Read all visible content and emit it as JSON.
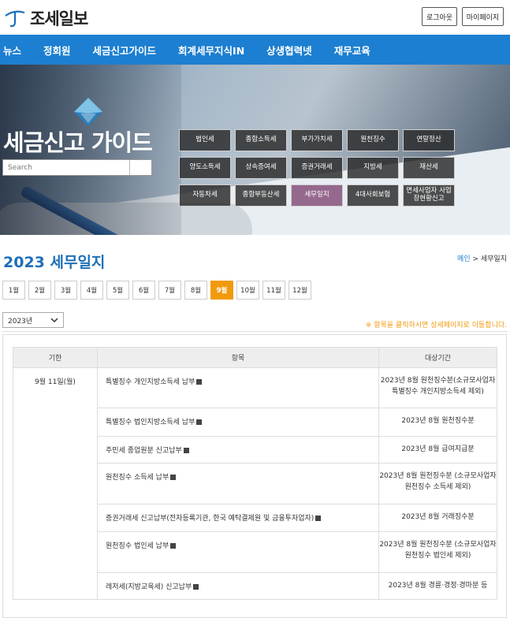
{
  "header": {
    "logo_text": "조세일보",
    "logout_label": "로그아웃",
    "mypage_label": "마이페이지"
  },
  "nav": {
    "items": [
      "뉴스",
      "정회원",
      "세금신고가이드",
      "회계세무지식IN",
      "상생협력넷",
      "재무교육"
    ]
  },
  "banner": {
    "title": "세금신고 가이드",
    "search_placeholder": "Search",
    "tax_buttons": [
      "법인세",
      "종합소득세",
      "부가가치세",
      "원천징수",
      "연말정산",
      "양도소득세",
      "상속증여세",
      "증권거래세",
      "지방세",
      "재산세",
      "자동차세",
      "종합부동산세",
      "세무일지",
      "4대사회보험",
      "면세사업자 사업장현황신고"
    ],
    "active_button": "세무일지"
  },
  "page": {
    "title": "2023 세무일지",
    "breadcrumb_home": "메인",
    "breadcrumb_sep": " > ",
    "breadcrumb_current": "세무일지"
  },
  "months": [
    "1월",
    "2월",
    "3월",
    "4월",
    "5월",
    "6월",
    "7월",
    "8월",
    "9월",
    "10월",
    "11월",
    "12월"
  ],
  "active_month": "9월",
  "year_select": "2023년",
  "notice": "※  항목을 클릭하시면 상세페이지로 이동합니다.",
  "table": {
    "headers": [
      "기한",
      "항목",
      "대상기간"
    ],
    "date_group": "9월 11일(월)",
    "rows": [
      {
        "item": "특별징수 개인지방소득세 납부",
        "period": "2023년 8월 원천징수분(소규모사업자 특별징수 개인지방소득세 제외)"
      },
      {
        "item": "특별징수 법인지방소득세 납부",
        "period": "2023년 8월 원천징수분"
      },
      {
        "item": "주민세 종업원분 신고납부",
        "period": "2023년 8월 급여지급분"
      },
      {
        "item": "원천징수 소득세 납부",
        "period": "2023년 8월 원천징수분 (소규모사업자 원천징수 소득세 제외)"
      },
      {
        "item": "증권거래세 신고납부(전자등록기관, 한국 예탁결제원 및 금융투자업자)",
        "period": "2023년 8월 거래징수분"
      },
      {
        "item": "원천징수 법인세 납부",
        "period": "2023년 8월 원천징수분 (소규모사업자 원천징수 법인세 제외)"
      },
      {
        "item": "레저세(지방교육세) 신고납부",
        "period": "2023년 8월 경륜·경정·경마분 등"
      }
    ]
  },
  "colors": {
    "nav_blue": "#1d7fd1",
    "accent_orange": "#f19a0c",
    "title_blue": "#1d6fb8"
  }
}
